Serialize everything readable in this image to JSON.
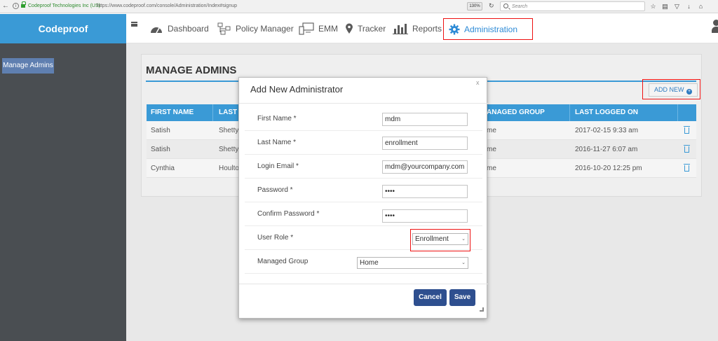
{
  "browser": {
    "site_identity": "Codeproof Technologies Inc (US)",
    "url": "https://www.codeproof.com/console/Administration/Index#signup",
    "zoom": "130%",
    "search_placeholder": "Search"
  },
  "sidebar": {
    "logo": "Codeproof",
    "items": [
      {
        "label": "Manage Admins"
      }
    ]
  },
  "topnav": {
    "items": [
      {
        "label": "Dashboard"
      },
      {
        "label": "Policy Manager"
      },
      {
        "label": "EMM"
      },
      {
        "label": "Tracker"
      },
      {
        "label": "Reports"
      },
      {
        "label": "Administration"
      }
    ]
  },
  "page": {
    "title": "MANAGE ADMINS",
    "add_new_label": "ADD NEW"
  },
  "table": {
    "headers": [
      "FIRST NAME",
      "LAST N",
      "ANAGED GROUP",
      "LAST LOGGED ON"
    ],
    "rows": [
      {
        "first": "Satish",
        "last": "Shetty",
        "group": "me",
        "logged": "2017-02-15 9:33 am"
      },
      {
        "first": "Satish",
        "last": "Shetty",
        "group": "me",
        "logged": "2016-11-27 6:07 am"
      },
      {
        "first": "Cynthia",
        "last": "Houlto",
        "group": "me",
        "logged": "2016-10-20 12:25 pm"
      }
    ]
  },
  "modal": {
    "title": "Add New Administrator",
    "close": "x",
    "fields": [
      {
        "label": "First Name *",
        "value": "mdm"
      },
      {
        "label": "Last Name *",
        "value": "enrollment"
      },
      {
        "label": "Login Email *",
        "value": "mdm@yourcompany.com"
      },
      {
        "label": "Password *",
        "value": "••••"
      },
      {
        "label": "Confirm Password *",
        "value": "••••"
      },
      {
        "label": "User Role *",
        "value": "Enrollment"
      },
      {
        "label": "Managed Group",
        "value": "Home"
      }
    ],
    "cancel_label": "Cancel",
    "save_label": "Save"
  },
  "colors": {
    "brand_blue": "#3a9ad6",
    "sidebar_dark": "#4a4e52",
    "button_navy": "#2e4f8f",
    "highlight_red": "#ee1111"
  }
}
